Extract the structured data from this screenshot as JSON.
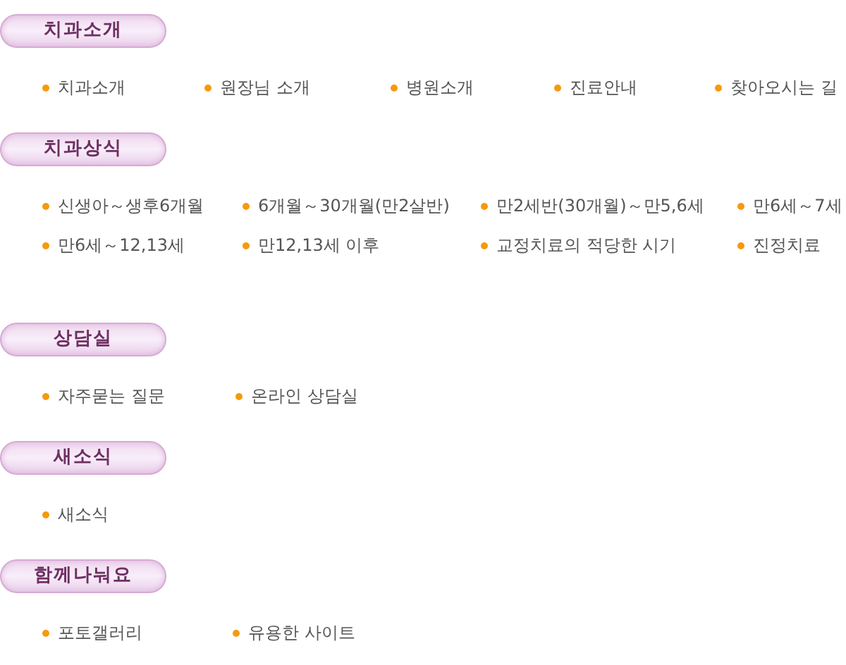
{
  "sections": [
    {
      "title": "치과소개",
      "links": [
        "치과소개",
        "원장님 소개",
        "병원소개",
        "진료안내",
        "찾아오시는 길"
      ]
    },
    {
      "title": "치과상식",
      "links": [
        "신생아～생후6개월",
        "6개월～30개월(만2살반)",
        "만2세반(30개월)～만5,6세",
        "만6세～7세",
        "만6세～12,13세",
        "만12,13세 이후",
        "교정치료의 적당한 시기",
        "진정치료"
      ]
    },
    {
      "title": "상담실",
      "links": [
        "자주묻는 질문",
        "온라인 상담실"
      ]
    },
    {
      "title": "새소식",
      "links": [
        "새소식"
      ]
    },
    {
      "title": "함께나눠요",
      "links": [
        "포토갤러리",
        "유용한 사이트"
      ]
    }
  ]
}
